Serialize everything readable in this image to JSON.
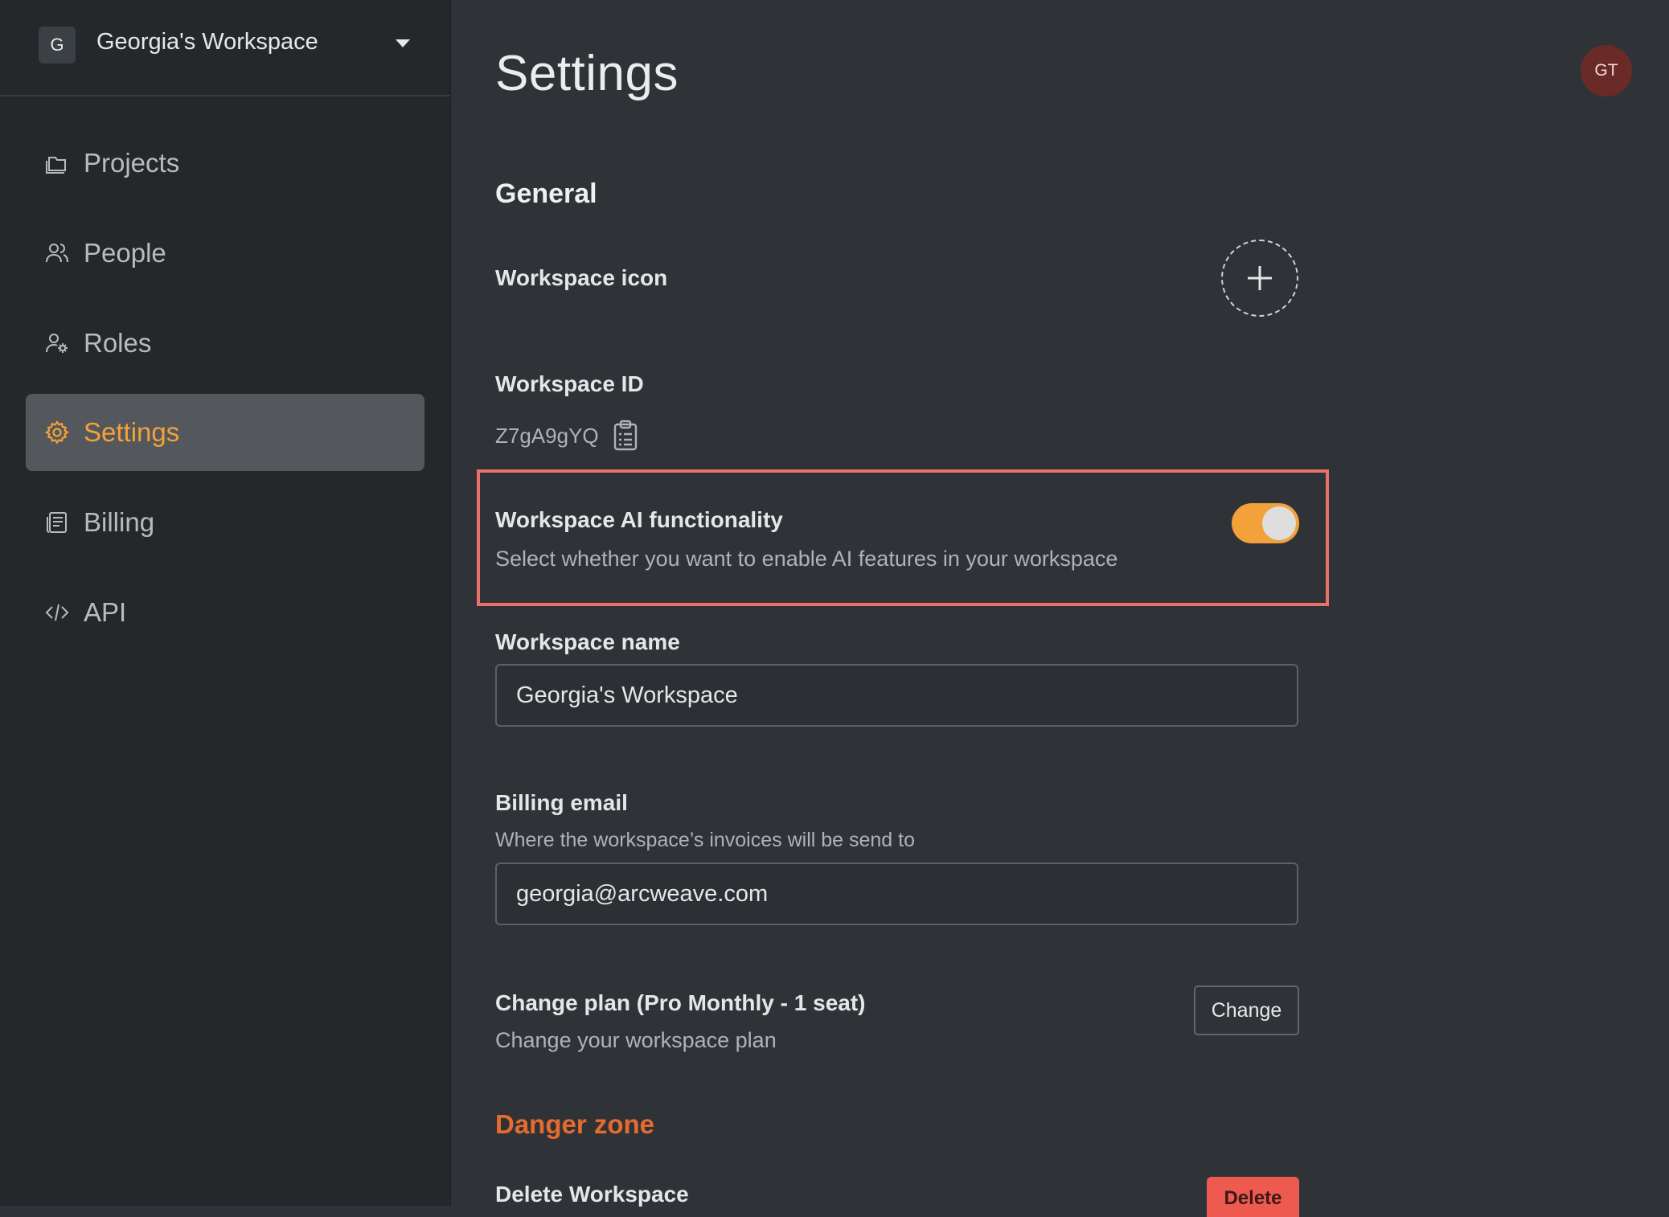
{
  "workspace_switcher": {
    "initial": "G",
    "name": "Georgia's Workspace"
  },
  "sidebar": {
    "items": [
      {
        "label": "Projects",
        "icon": "projects-icon"
      },
      {
        "label": "People",
        "icon": "people-icon"
      },
      {
        "label": "Roles",
        "icon": "roles-icon"
      },
      {
        "label": "Settings",
        "icon": "gear-icon",
        "active": true
      },
      {
        "label": "Billing",
        "icon": "billing-icon"
      },
      {
        "label": "API",
        "icon": "code-icon"
      }
    ]
  },
  "header": {
    "title": "Settings",
    "user_initials": "GT"
  },
  "general": {
    "heading": "General",
    "icon_label": "Workspace icon",
    "id_label": "Workspace ID",
    "id_value": "Z7gA9gYQ",
    "ai": {
      "label": "Workspace AI functionality",
      "description": "Select whether you want to enable AI features in your workspace",
      "enabled": true
    },
    "name_label": "Workspace name",
    "name_value": "Georgia's Workspace",
    "billing_label": "Billing email",
    "billing_description": "Where the workspace’s invoices will be send to",
    "billing_value": "georgia@arcweave.com",
    "plan_label": "Change plan (Pro Monthly - 1 seat)",
    "plan_description": "Change your workspace plan",
    "change_button": "Change"
  },
  "danger": {
    "heading": "Danger zone",
    "delete_label": "Delete Workspace",
    "delete_button": "Delete"
  },
  "colors": {
    "accent": "#f3a13a",
    "danger": "#e66b2e",
    "delete_button": "#ef5a50",
    "highlight_border": "#e8716a"
  }
}
